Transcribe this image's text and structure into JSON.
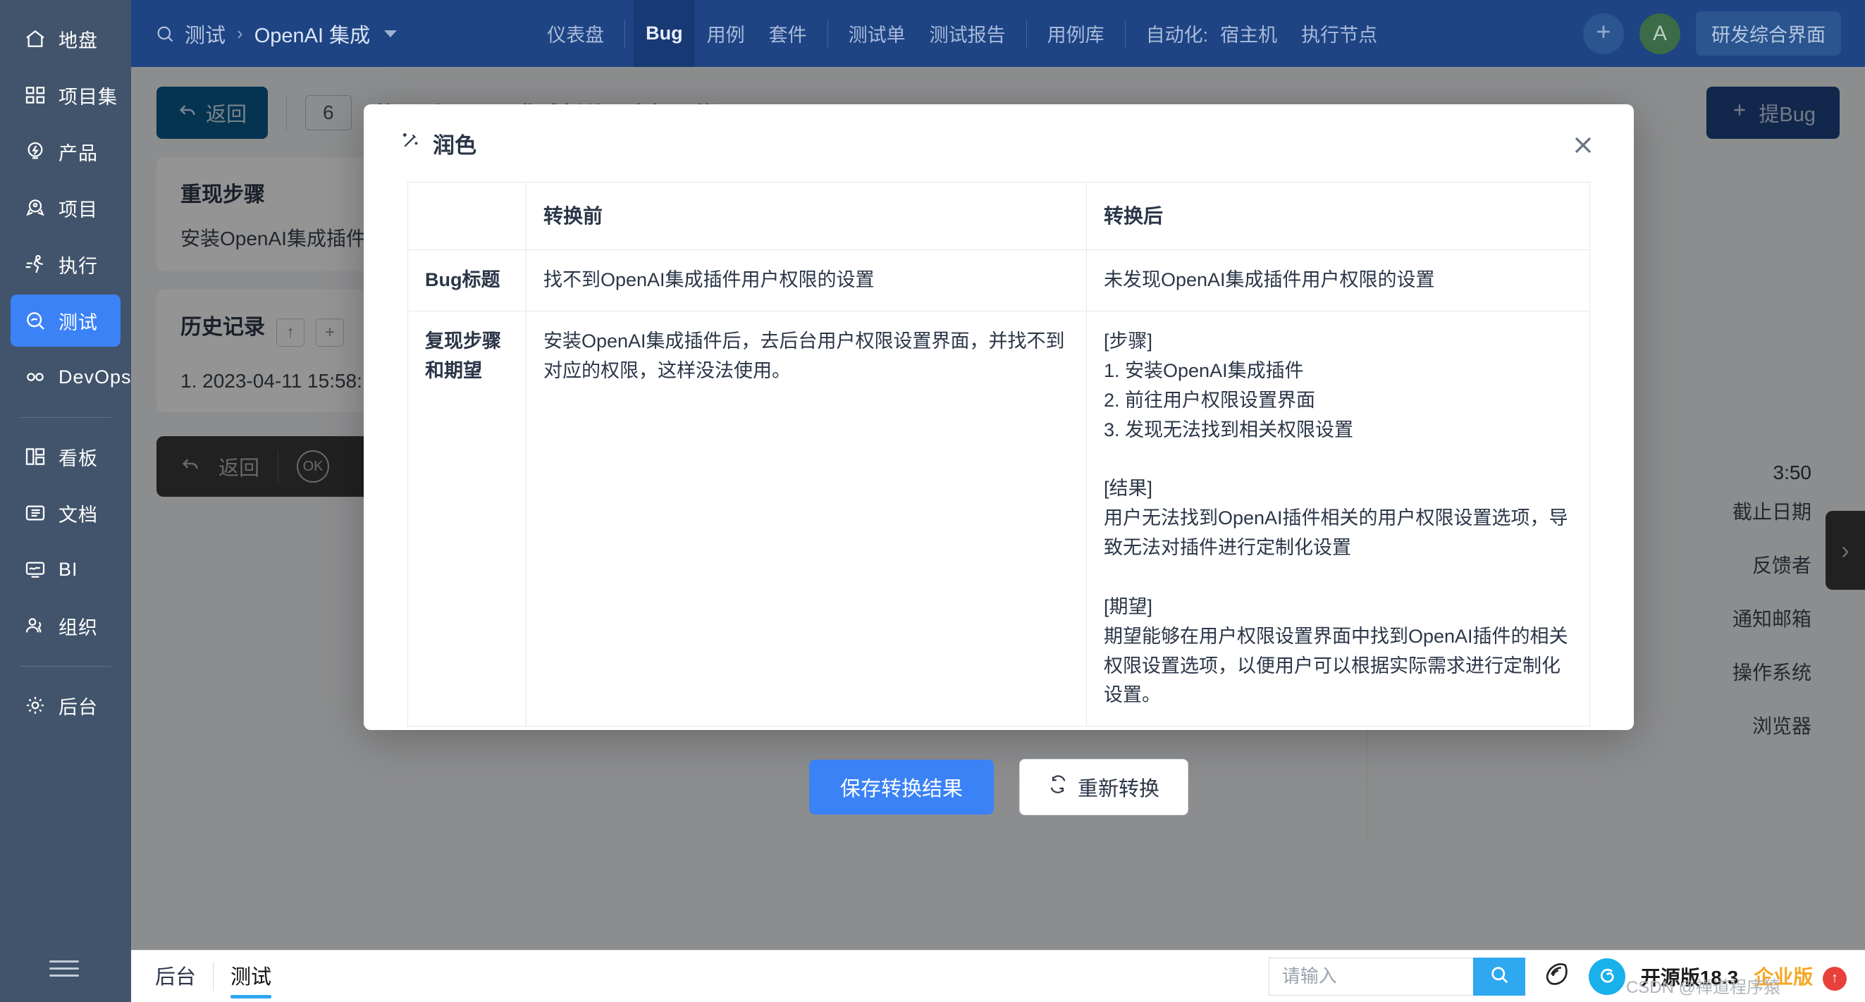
{
  "sidebar": {
    "items": [
      {
        "label": "地盘",
        "icon": "home-icon",
        "active": false
      },
      {
        "label": "项目集",
        "icon": "grid-icon",
        "active": false
      },
      {
        "label": "产品",
        "icon": "bulb-icon",
        "active": false
      },
      {
        "label": "项目",
        "icon": "rocket-icon",
        "active": false
      },
      {
        "label": "执行",
        "icon": "runner-icon",
        "active": false
      },
      {
        "label": "测试",
        "icon": "magnifier-icon",
        "active": true
      },
      {
        "label": "DevOps",
        "icon": "infinity-icon",
        "active": false
      }
    ],
    "items2": [
      {
        "label": "看板",
        "icon": "kanban-icon"
      },
      {
        "label": "文档",
        "icon": "document-icon"
      },
      {
        "label": "BI",
        "icon": "chart-icon"
      },
      {
        "label": "组织",
        "icon": "users-icon"
      }
    ],
    "items3": [
      {
        "label": "后台",
        "icon": "gear-icon"
      }
    ],
    "collapse_icon": "hamburger-icon"
  },
  "topbar": {
    "breadcrumb_root": "测试",
    "breadcrumb_current": "OpenAI 集成",
    "tabs": [
      {
        "label": "仪表盘",
        "active": false,
        "divider_after": true
      },
      {
        "label": "Bug",
        "active": true,
        "divider_after": false
      },
      {
        "label": "用例",
        "active": false,
        "divider_after": false
      },
      {
        "label": "套件",
        "active": false,
        "divider_after": true
      },
      {
        "label": "测试单",
        "active": false,
        "divider_after": false
      },
      {
        "label": "测试报告",
        "active": false,
        "divider_after": true
      },
      {
        "label": "用例库",
        "active": false,
        "divider_after": true
      }
    ],
    "automation_label": "自动化:",
    "automation_tabs": [
      {
        "label": "宿主机"
      },
      {
        "label": "执行节点"
      }
    ],
    "add_button": "plus-icon",
    "avatar_initial": "A",
    "workspace_button": "研发综合界面"
  },
  "page": {
    "back_button": "返回",
    "bug_id": "6",
    "bug_title": "找不到OpenAI集成插件用户权限的设置",
    "new_bug_button": "提Bug",
    "steps_card": {
      "heading": "重现步骤",
      "text": "安装OpenAI集成插件"
    },
    "history_card": {
      "heading": "历史记录",
      "up_icon": "arrow-up-icon",
      "add_icon": "plus-icon",
      "entry": "1. 2023-04-11 15:58:"
    },
    "dark_bar": {
      "back": "返回",
      "ok_icon": "ok-circle-icon"
    },
    "right_fields": [
      "截止日期",
      "反馈者",
      "通知邮箱",
      "操作系统",
      "浏览器"
    ],
    "right_time": "3:50",
    "edge_tab_icon": "chevron-right-icon"
  },
  "modal": {
    "title": "润色",
    "title_icon": "magic-wand-icon",
    "close_icon": "close-icon",
    "table": {
      "headers": [
        "",
        "转换前",
        "转换后"
      ],
      "rows": [
        {
          "label": "Bug标题",
          "before": "找不到OpenAI集成插件用户权限的设置",
          "after": "未发现OpenAI集成插件用户权限的设置"
        },
        {
          "label": "复现步骤和期望",
          "before": "安装OpenAI集成插件后，去后台用户权限设置界面，并找不到对应的权限，这样没法使用。",
          "after": "[步骤]\n1. 安装OpenAI集成插件\n2. 前往用户权限设置界面\n3. 发现无法找到相关权限设置\n\n[结果]\n用户无法找到OpenAI插件相关的用户权限设置选项，导致无法对插件进行定制化设置\n\n[期望]\n期望能够在用户权限设置界面中找到OpenAI插件的相关权限设置选项，以便用户可以根据实际需求进行定制化设置。"
        }
      ]
    },
    "save_button": "保存转换结果",
    "retry_button": "重新转换",
    "retry_icon": "refresh-icon"
  },
  "bottombar": {
    "left_items": [
      {
        "label": "后台",
        "active": false
      },
      {
        "label": "测试",
        "active": true
      }
    ],
    "search_placeholder": "请输入",
    "search_icon": "search-icon",
    "shell_icon": "conch-icon",
    "logo_icon": "zentao-logo",
    "version": "开源版18.3",
    "enterprise_badge": "企业版",
    "upgrade_icon": "arrow-up-circle-icon",
    "watermark": "CSDN @禅道程序猿"
  },
  "colors": {
    "sidebar_bg": "#41546b",
    "topbar_bg": "#1e4484",
    "accent_blue": "#3b82f6",
    "active_tab_bg": "#173a74",
    "search_blue": "#2ea8f0"
  }
}
